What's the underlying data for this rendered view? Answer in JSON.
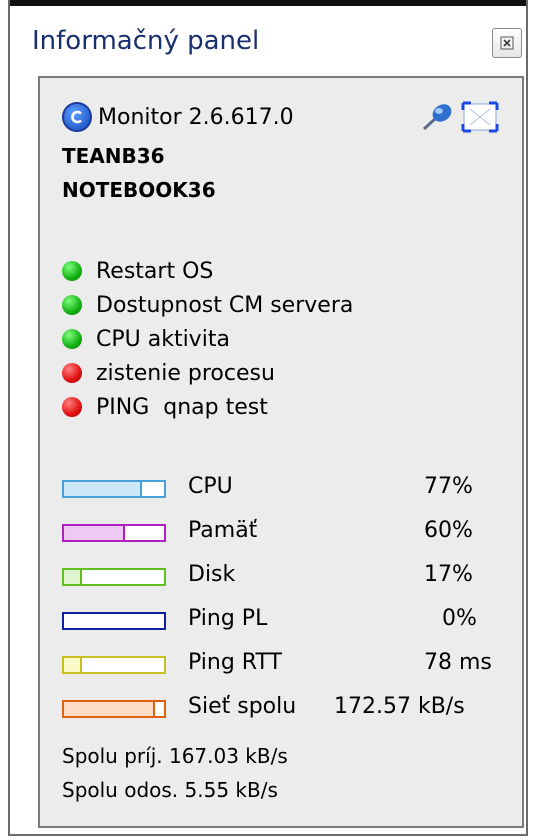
{
  "window": {
    "title": "Informačný panel"
  },
  "app": {
    "name": "Monitor 2.6.617.0",
    "hosts": [
      "TEANB36",
      "NOTEBOOK36"
    ]
  },
  "status": [
    {
      "label": "Restart OS",
      "state": "ok",
      "color": "#12b012"
    },
    {
      "label": "Dostupnost CM servera",
      "state": "ok",
      "color": "#12b012"
    },
    {
      "label": "CPU aktivita",
      "state": "ok",
      "color": "#12b012"
    },
    {
      "label": "zistenie procesu",
      "state": "error",
      "color": "#e01010"
    },
    {
      "label": "PING  qnap test",
      "state": "error",
      "color": "#e01010"
    }
  ],
  "metrics": [
    {
      "label": "CPU",
      "value": "77%",
      "level": 0.77,
      "color": "#4aa0d8",
      "fill": "#cce8f8"
    },
    {
      "label": "Pamäť",
      "value": "60%",
      "level": 0.6,
      "color": "#b020c0",
      "fill": "#f0c8f4"
    },
    {
      "label": "Disk",
      "value": "17%",
      "level": 0.17,
      "color": "#60c020",
      "fill": "#e0f4d0"
    },
    {
      "label": "Ping PL",
      "value": "0%",
      "level": 0.0,
      "color": "#1020a0",
      "fill": "#ffffff"
    },
    {
      "label": "Ping RTT",
      "value": "78 ms",
      "level": 0.17,
      "color": "#c8c020",
      "fill": "#fafac8"
    },
    {
      "label": "Sieť spolu",
      "value": "172.57 kB/s",
      "level": 0.9,
      "color": "#e06010",
      "fill": "#fcdcc4"
    }
  ],
  "summary": {
    "received": "Spolu príj. 167.03 kB/s",
    "sent": "Spolu odos. 5.55 kB/s"
  },
  "icons": {
    "close": "close-icon",
    "pin": "pin-icon",
    "expand": "expand-icon",
    "logo": "monitor-logo-icon"
  }
}
